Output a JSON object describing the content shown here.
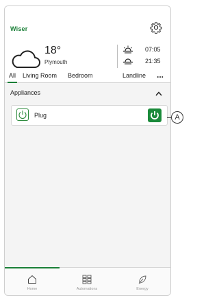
{
  "header": {
    "logo_text": "Wiser",
    "temperature": "18°",
    "city": "Plymouth",
    "sunrise": "07:05",
    "sunset": "21:35",
    "tabs": [
      "All",
      "Living Room",
      "Bedroom",
      "Landline"
    ],
    "more_label": "..."
  },
  "section": {
    "title": "Appliances"
  },
  "devices": [
    {
      "label": "Plug",
      "state": "on"
    }
  ],
  "callout": {
    "label": "A"
  },
  "bottom_nav": [
    {
      "label": "Home",
      "icon": "home-icon",
      "active": true
    },
    {
      "label": "Automations",
      "icon": "grid-icon",
      "active": false
    },
    {
      "label": "Energy",
      "icon": "leaf-icon",
      "active": false
    }
  ],
  "colors": {
    "accent": "#1a7f37",
    "toggle": "#1a8a3a",
    "background": "#f4f4f4"
  }
}
